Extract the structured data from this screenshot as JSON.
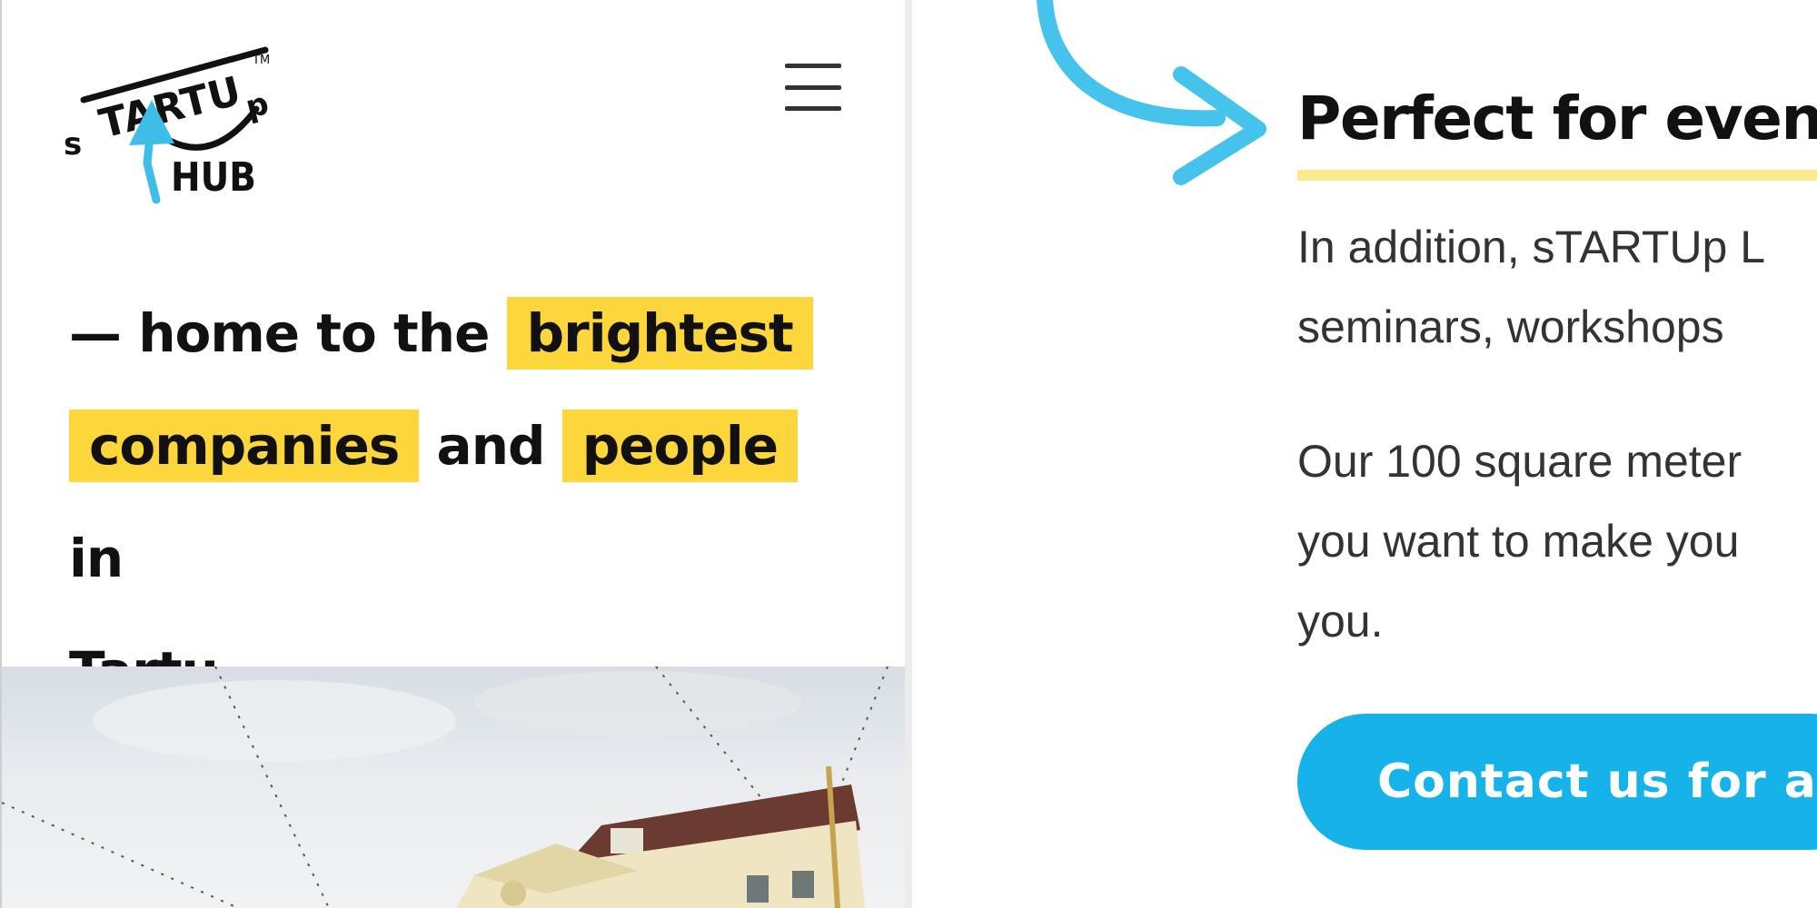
{
  "brand": {
    "logo_text": "sTARTUp HUB",
    "colors": {
      "accent_yellow": "#fdd63c",
      "accent_blue": "#16b3ea",
      "logo_arrow": "#3fbde9"
    }
  },
  "header": {
    "menu_icon": "hamburger-icon"
  },
  "hero": {
    "lead": "— home to the ",
    "highlight_1": "brightest",
    "highlight_2": "companies",
    "mid": " and ",
    "highlight_3": "people",
    "tail_1": " in",
    "tail_2": "Tartu"
  },
  "events": {
    "title": "Perfect for events",
    "paragraph_1": [
      "In addition, sTARTUp L",
      "seminars, workshops"
    ],
    "paragraph_2": [
      "Our 100 square meter",
      "you want to make you",
      "you."
    ],
    "cta_label": "Contact us for an"
  }
}
